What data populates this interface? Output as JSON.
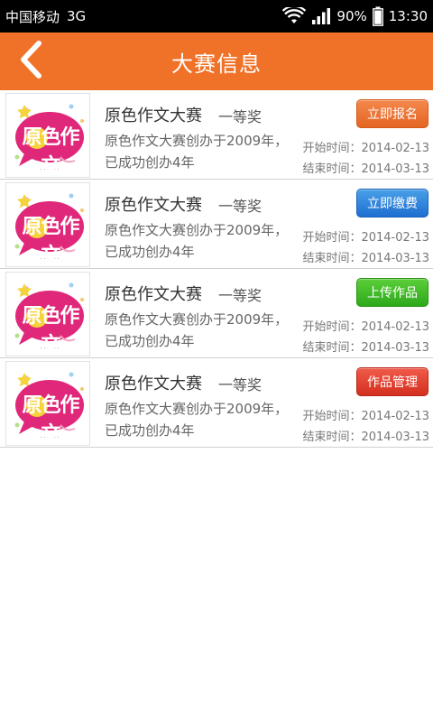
{
  "status_bar": {
    "carrier": "中国移动",
    "network": "3G",
    "battery": "90%",
    "time": "13:30",
    "icons": [
      "wifi-icon",
      "signal-icon",
      "battery-icon"
    ]
  },
  "header": {
    "title": "大赛信息",
    "back_icon": "chevron-left-icon",
    "color": "#f07228"
  },
  "contests": [
    {
      "name": "原色作文大赛",
      "award": "一等奖",
      "desc": "原色作文大赛创办于2009年，已成功创办4年",
      "start": "开始时间：2014-02-13",
      "end": "结束时间：2014-03-13",
      "action": "立即报名",
      "action_color": "#e96a2a",
      "logo_text": "原色作文"
    },
    {
      "name": "原色作文大赛",
      "award": "一等奖",
      "desc": "原色作文大赛创办于2009年，已成功创办4年",
      "start": "开始时间：2014-02-13",
      "end": "结束时间：2014-03-13",
      "action": "立即缴费",
      "action_color": "#2a7fdc",
      "logo_text": "原色作文"
    },
    {
      "name": "原色作文大赛",
      "award": "一等奖",
      "desc": "原色作文大赛创办于2009年，已成功创办4年",
      "start": "开始时间：2014-02-13",
      "end": "结束时间：2014-03-13",
      "action": "上传作品",
      "action_color": "#3bb526",
      "logo_text": "原色作文"
    },
    {
      "name": "原色作文大赛",
      "award": "一等奖",
      "desc": "原色作文大赛创办于2009年，已成功创办4年",
      "start": "开始时间：2014-02-13",
      "end": "结束时间：2014-03-13",
      "action": "作品管理",
      "action_color": "#de3a2a",
      "logo_text": "原色作文"
    }
  ]
}
